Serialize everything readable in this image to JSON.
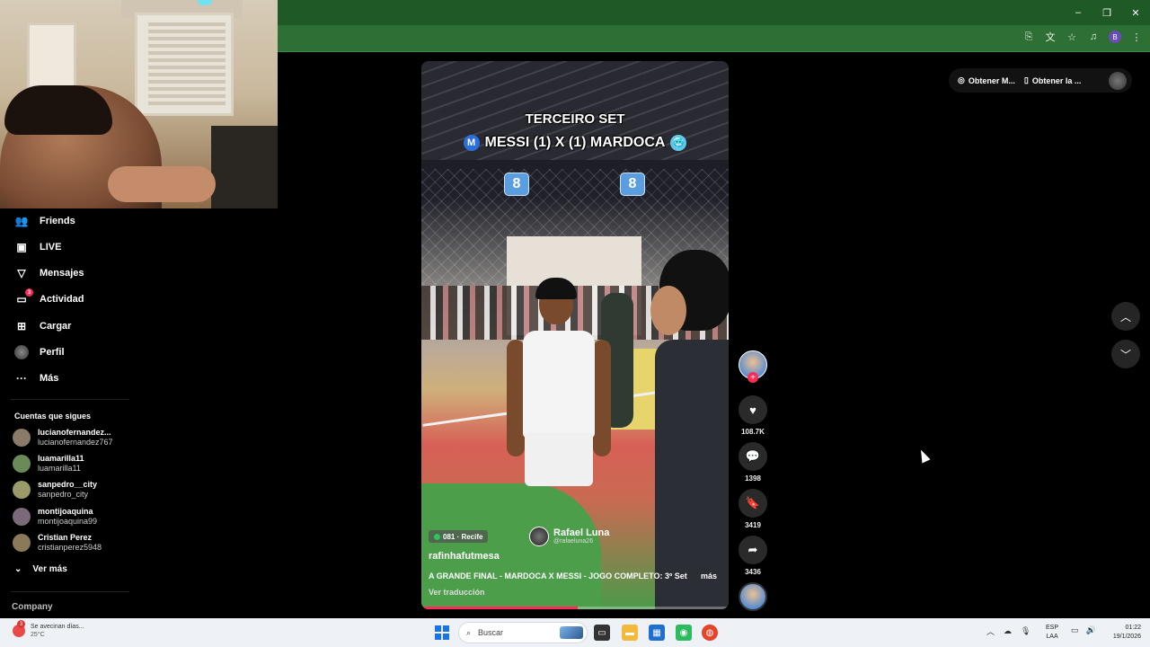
{
  "window_controls": {
    "minimize": "–",
    "maximize": "❐",
    "close": "✕"
  },
  "browser_toolbar": {
    "profile_initial": "B"
  },
  "sidebar": {
    "nav": [
      {
        "label": "Friends",
        "icon": "friends-icon",
        "glyph": "👥"
      },
      {
        "label": "LIVE",
        "icon": "live-icon",
        "glyph": "▣"
      },
      {
        "label": "Mensajes",
        "icon": "messages-icon",
        "glyph": "▽"
      },
      {
        "label": "Actividad",
        "icon": "activity-icon",
        "glyph": "▭",
        "badge": "3"
      },
      {
        "label": "Cargar",
        "icon": "upload-icon",
        "glyph": "⊞"
      },
      {
        "label": "Perfil",
        "icon": "profile-avatar"
      },
      {
        "label": "Más",
        "icon": "more-icon",
        "glyph": "···"
      }
    ],
    "following_title": "Cuentas que sigues",
    "following": [
      {
        "name": "lucianofernandez...",
        "username": "lucianofernandez767",
        "color": "#8a7a6a"
      },
      {
        "name": "luamarilla11",
        "username": "luamarilla11",
        "color": "#6a8a5a"
      },
      {
        "name": "sanpedro__city",
        "username": "sanpedro_city",
        "color": "#9a9a6a"
      },
      {
        "name": "montijoaquina",
        "username": "montijoaquina99",
        "color": "#7a6a7a"
      },
      {
        "name": "Cristian Perez",
        "username": "cristianperez5948",
        "color": "#8a7a5a"
      }
    ],
    "see_more": "Ver más",
    "company": "Company"
  },
  "video": {
    "overlay_title": "TERCEIRO SET",
    "overlay_score": "MESSI (1) X (1) MARDOCA",
    "m_badge": "M",
    "face_emoji": "🥶",
    "number_left": "8",
    "number_right": "8",
    "location": "081 · Recife",
    "watermark_name": "Rafael Luna",
    "watermark_handle": "@rafaeluna26",
    "author": "rafinhafutmesa",
    "description": "A GRANDE FINAL - MARDOCA X MESSI - JOGO COMPLETO: 3º Set",
    "more": "más",
    "translate": "Ver traducción",
    "progress": 0.51
  },
  "actions": {
    "follow_plus": "+",
    "like_count": "108.7K",
    "comment_count": "1398",
    "save_count": "3419",
    "share_count": "3436"
  },
  "get_app": {
    "item1": "Obtener M...",
    "item2": "Obtener la ..."
  },
  "taskbar": {
    "weather_badge": "3",
    "weather_text": "Se avecinan días...",
    "temperature": "25°C",
    "search_placeholder": "Buscar",
    "lang_line1": "ESP",
    "lang_line2": "LAA",
    "time": "01:22",
    "date": "19/1/2026"
  }
}
